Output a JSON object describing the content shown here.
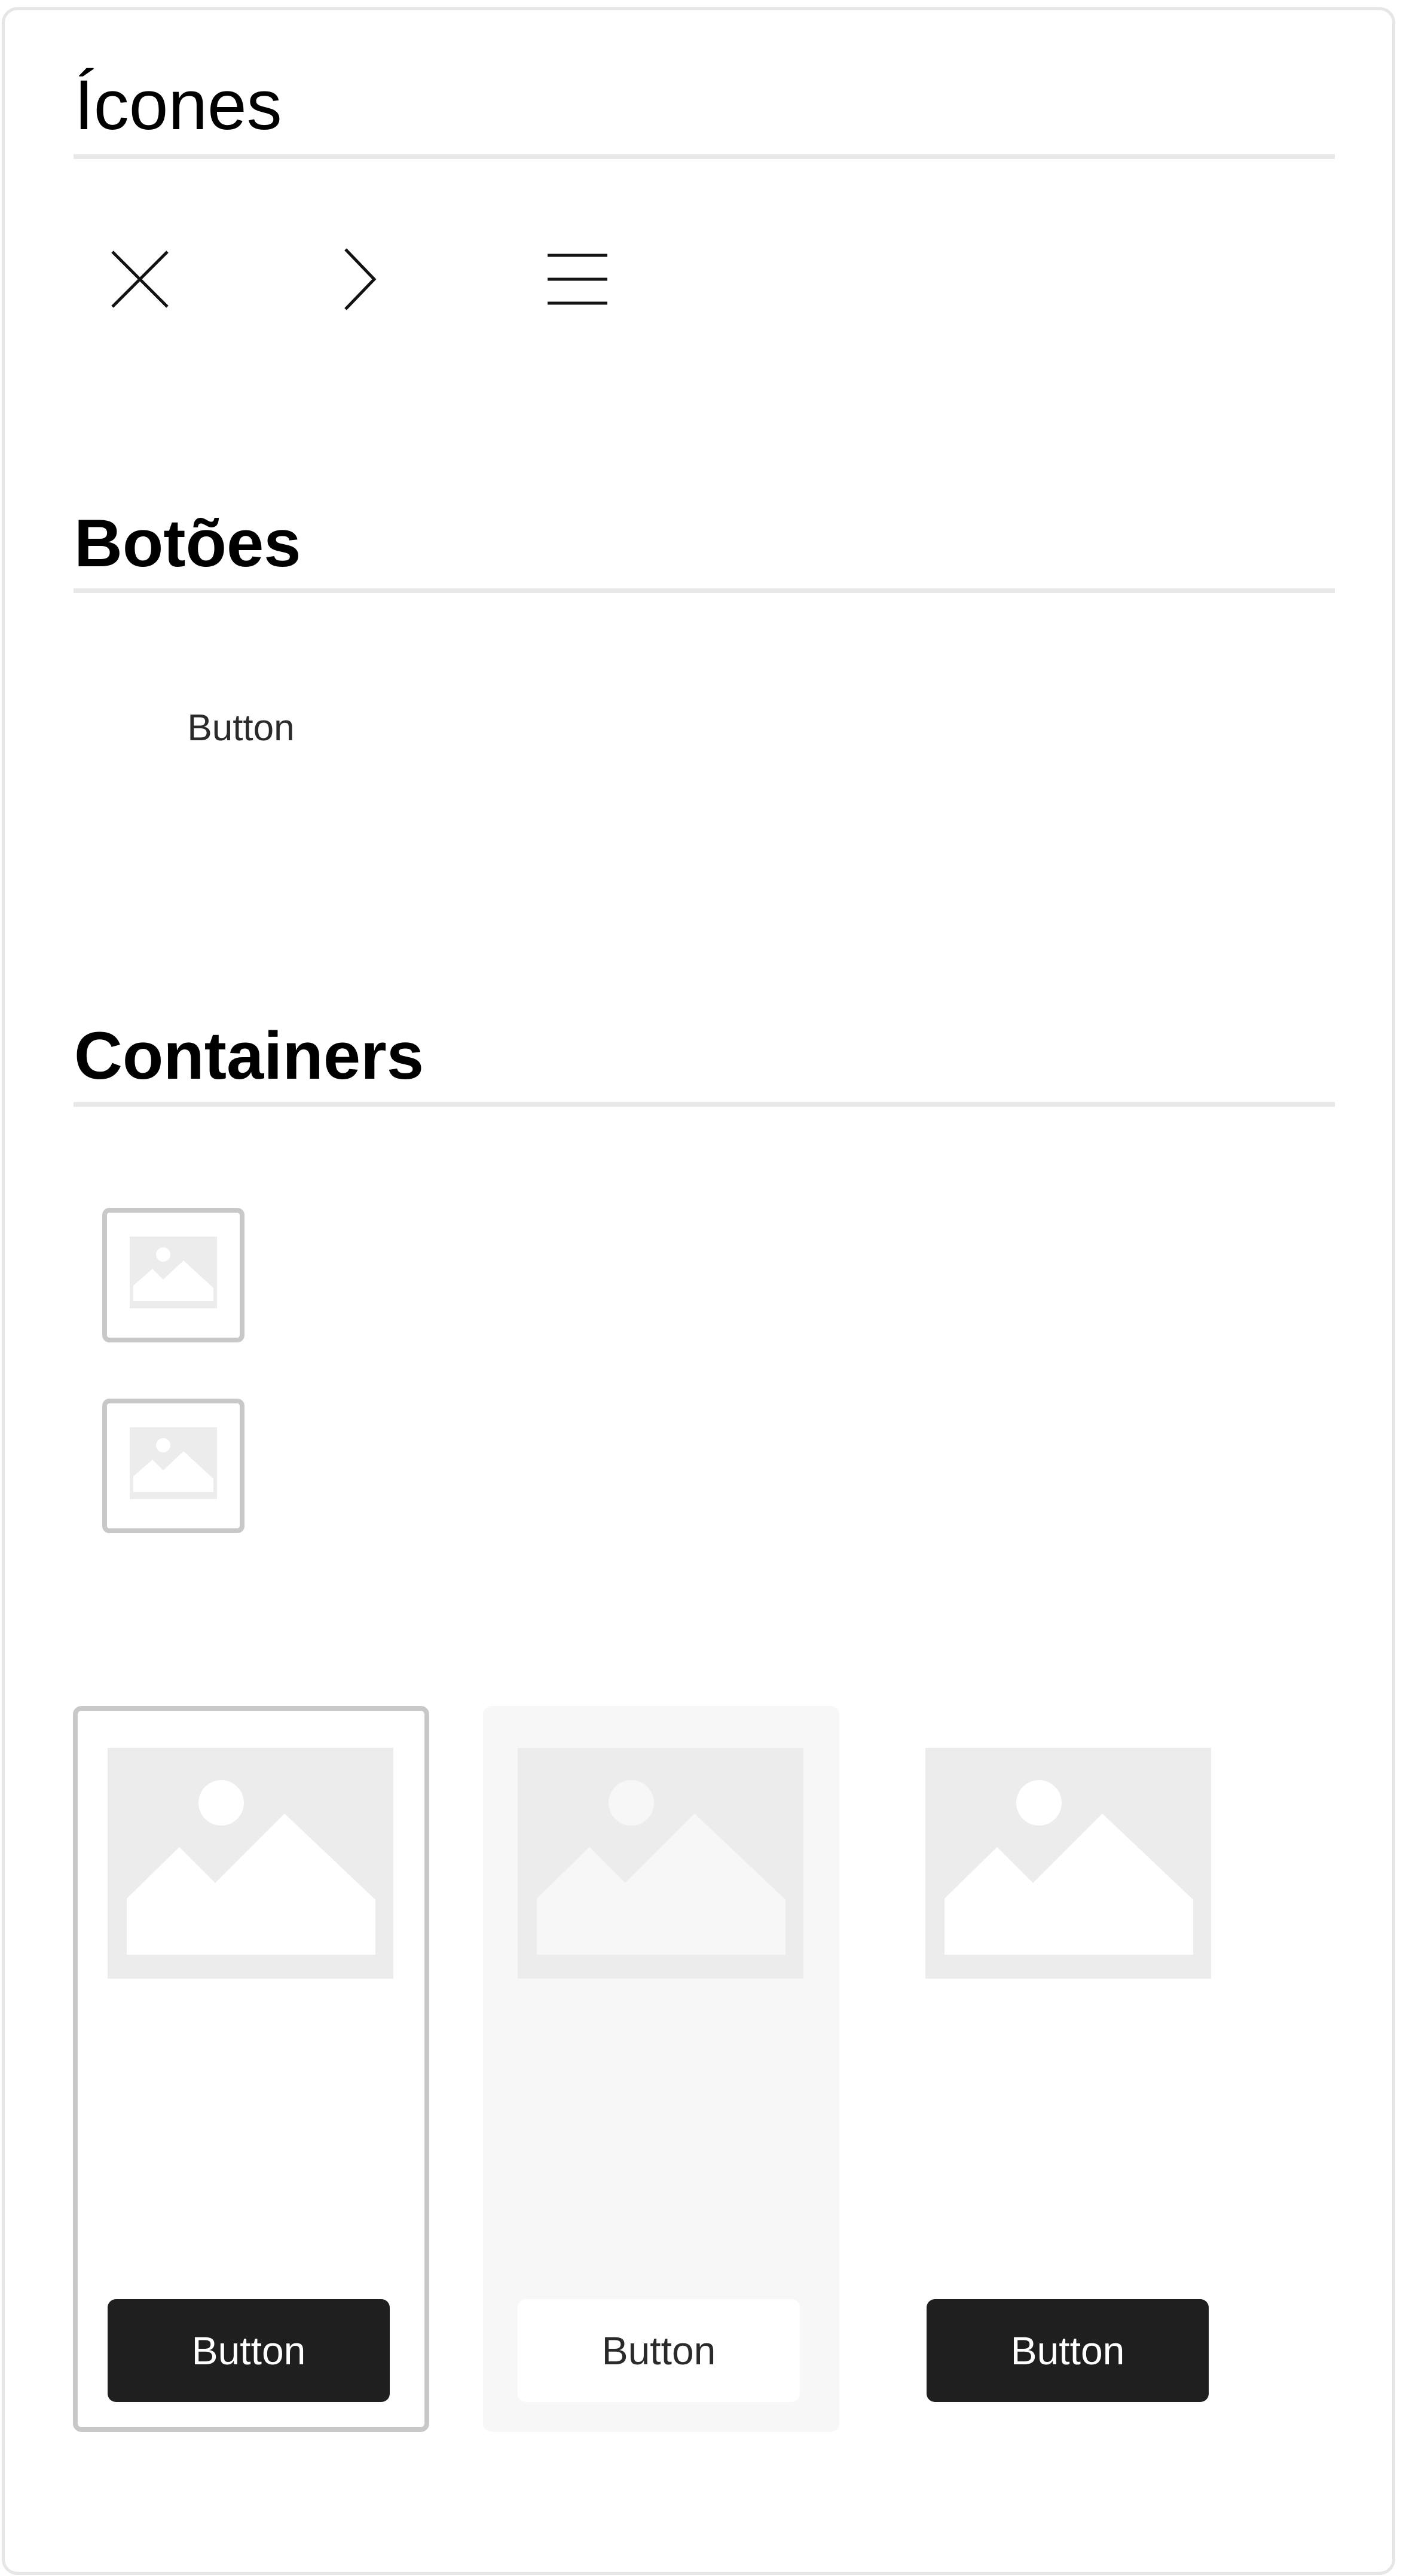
{
  "sections": {
    "icons": {
      "title": "Ícones",
      "items": [
        {
          "icon": "close-icon"
        },
        {
          "icon": "chevron-right-icon"
        },
        {
          "icon": "menu-icon"
        }
      ]
    },
    "buttons": {
      "title": "Botões",
      "text_button_label": "Button"
    },
    "containers": {
      "title": "Containers",
      "thumbnails": [
        {
          "icon": "image-placeholder-icon"
        },
        {
          "icon": "image-placeholder-icon"
        }
      ],
      "cards": [
        {
          "style": "outlined",
          "icon": "image-placeholder-icon",
          "button_label": "Button",
          "button_style": "dark"
        },
        {
          "style": "filled",
          "icon": "image-placeholder-icon",
          "button_label": "Button",
          "button_style": "light"
        },
        {
          "style": "plain",
          "icon": "image-placeholder-icon",
          "button_label": "Button",
          "button_style": "dark"
        }
      ]
    }
  },
  "colors": {
    "divider": "#e8e8e8",
    "border": "#c8c8c8",
    "placeholder": "#ececec",
    "placeholder_shape": "#ffffff",
    "placeholder_shape_filled": "#f7f7f7",
    "dark_button": "#1f1f1f",
    "filled_card_bg": "#f7f7f7"
  }
}
